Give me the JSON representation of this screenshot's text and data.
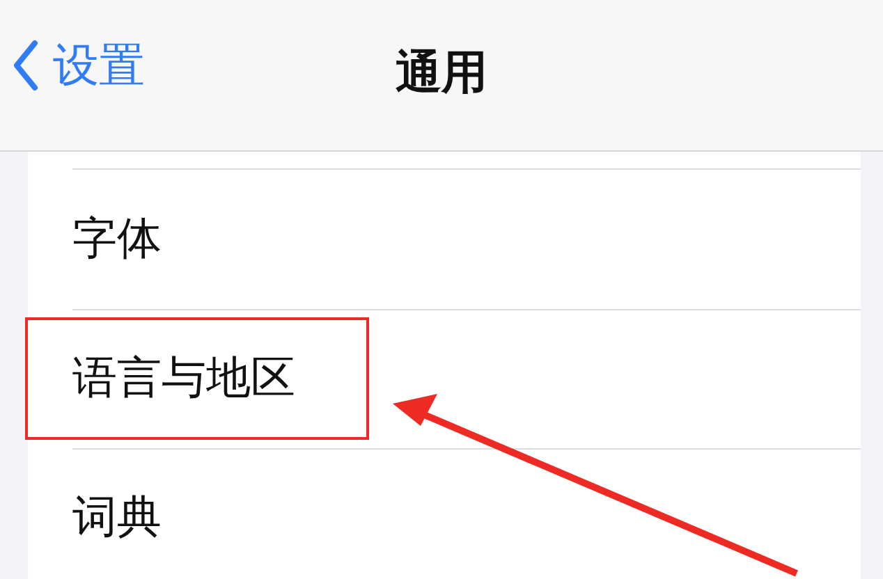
{
  "nav_bar": {
    "back_label": "设置",
    "title": "通用"
  },
  "rows": [
    {
      "label": "字体",
      "highlighted": false
    },
    {
      "label": "语言与地区",
      "highlighted": true
    },
    {
      "label": "词典",
      "highlighted": false
    }
  ]
}
